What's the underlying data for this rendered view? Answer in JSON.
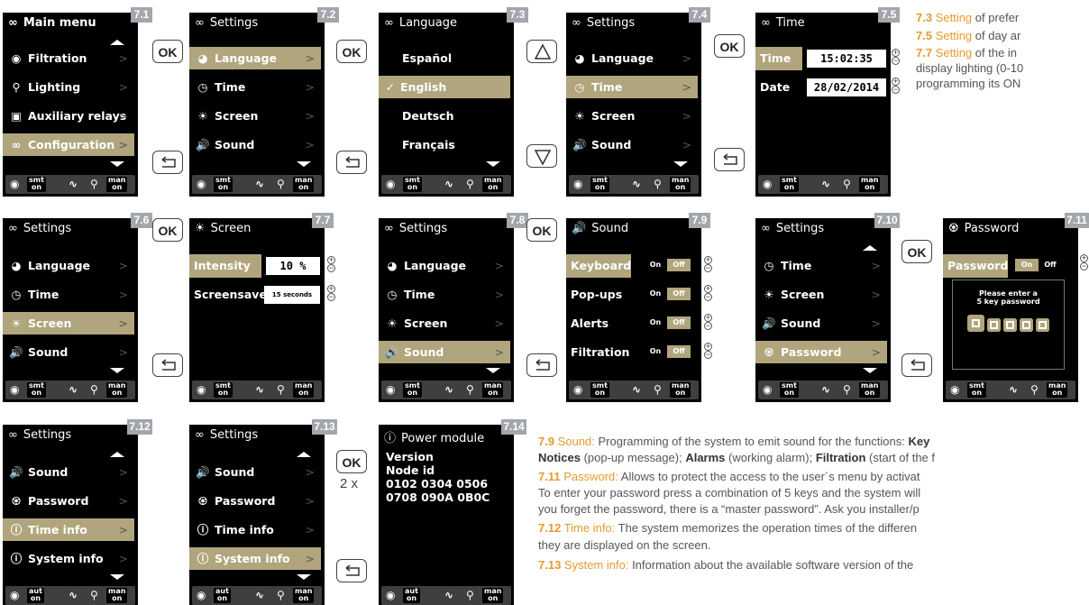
{
  "screens": {
    "s71": {
      "badge": "7.1",
      "title": "Main menu",
      "items": [
        "Filtration",
        "Lighting",
        "Auxiliary relays",
        "Configuration"
      ]
    },
    "s72": {
      "badge": "7.2",
      "title": "Settings",
      "items": [
        "Language",
        "Time",
        "Screen",
        "Sound"
      ]
    },
    "s73": {
      "badge": "7.3",
      "title": "Language",
      "items": [
        "Español",
        "English",
        "Deutsch",
        "Français"
      ]
    },
    "s74": {
      "badge": "7.4",
      "title": "Settings",
      "items": [
        "Language",
        "Time",
        "Screen",
        "Sound"
      ]
    },
    "s75": {
      "badge": "7.5",
      "title": "Time",
      "time_label": "Time",
      "time_value": "15:02:35",
      "date_label": "Date",
      "date_value": "28/02/2014"
    },
    "s76": {
      "badge": "7.6",
      "title": "Settings",
      "items": [
        "Language",
        "Time",
        "Screen",
        "Sound"
      ]
    },
    "s77": {
      "badge": "7.7",
      "title": "Screen",
      "intensity_label": "Intensity",
      "intensity_value": "10 %",
      "screensaver_label": "Screensave",
      "screensaver_value": "15 seconds"
    },
    "s78": {
      "badge": "7.8",
      "title": "Settings",
      "items": [
        "Language",
        "Time",
        "Screen",
        "Sound"
      ]
    },
    "s79": {
      "badge": "7.9",
      "title": "Sound",
      "rows": [
        "Keyboard",
        "Pop-ups",
        "Alerts",
        "Filtration"
      ],
      "on": "On",
      "off": "Off"
    },
    "s710": {
      "badge": "7.10",
      "title": "Settings",
      "items": [
        "Time",
        "Screen",
        "Sound",
        "Password"
      ]
    },
    "s711": {
      "badge": "7.11",
      "title": "Password",
      "label": "Password",
      "on": "On",
      "off": "Off",
      "prompt1": "Please enter a",
      "prompt2": "5 key password"
    },
    "s712": {
      "badge": "7.12",
      "title": "Settings",
      "items": [
        "Sound",
        "Password",
        "Time info",
        "System info"
      ]
    },
    "s713": {
      "badge": "7.13",
      "title": "Settings",
      "items": [
        "Sound",
        "Password",
        "Time info",
        "System info"
      ]
    },
    "s714": {
      "badge": "7.14",
      "title": "Power module",
      "lines": [
        "Version",
        "Node id",
        "0102 0304 0506",
        "0708 090A 0B0C"
      ]
    }
  },
  "status": {
    "smt": "smt",
    "on": "on",
    "man": "man",
    "aut": "aut"
  },
  "buttons": {
    "ok": "OK",
    "times": "2 x"
  },
  "text": {
    "t73a": "7.3",
    "t73b": " Setting ",
    "t73c": "of prefer",
    "t75a": "7.5",
    "t75b": " Setting ",
    "t75c": "of day ar",
    "t77a": "7.7",
    "t77b": " Setting ",
    "t77c": "of the in",
    "t77d": "display lighting (0-10",
    "t77e": "programming its ON",
    "t79a": "7.9",
    "t79b": " Sound:",
    "t79c": " Programming of the system to emit sound for the functions: ",
    "t79d": "Key",
    "t79e": "Notices",
    "t79f": " (pop-up message); ",
    "t79g": "Alarms",
    "t79h": " (working alarm); ",
    "t79i": "Filtration",
    "t79j": " (start of the f",
    "t711a": "7.11",
    "t711b": " Password:",
    "t711c": " Allows to protect the access to the user´s menu by activat",
    "t711d": "To enter your password press a combination of 5 keys and the system will",
    "t711e": "you forget the password, there is a “master password”. Ask you installer/p",
    "t712a": "7.12",
    "t712b": " Time info:",
    "t712c": " The system memorizes the operation times of the differen",
    "t712d": "they are displayed on the screen.",
    "t713a": "7.13",
    "t713b": " System info:",
    "t713c": " Information about the available software version of the"
  }
}
